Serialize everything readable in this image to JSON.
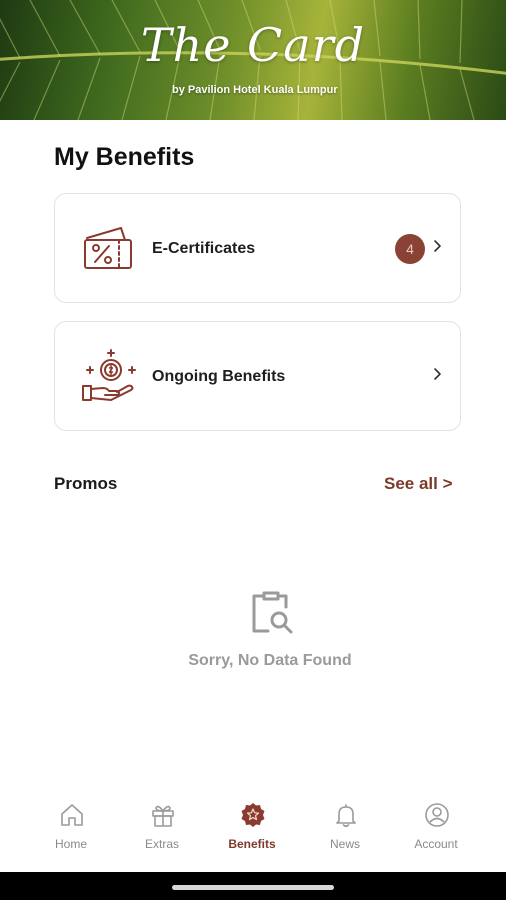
{
  "header": {
    "brand_title": "The Card",
    "brand_subtitle": "by Pavilion Hotel Kuala Lumpur"
  },
  "page": {
    "title": "My Benefits"
  },
  "benefits": [
    {
      "label": "E-Certificates",
      "icon": "ticket-percent-icon",
      "badge": "4"
    },
    {
      "label": "Ongoing Benefits",
      "icon": "hand-coins-icon"
    }
  ],
  "promos": {
    "title": "Promos",
    "see_all": "See all >",
    "empty_icon": "clipboard-search-icon",
    "empty_text": "Sorry, No Data Found"
  },
  "bottom_nav": {
    "items": [
      {
        "label": "Home",
        "icon": "home-icon"
      },
      {
        "label": "Extras",
        "icon": "gift-icon"
      },
      {
        "label": "Benefits",
        "icon": "badge-star-icon",
        "active": true
      },
      {
        "label": "News",
        "icon": "bell-icon"
      },
      {
        "label": "Account",
        "icon": "user-circle-icon"
      }
    ]
  },
  "colors": {
    "accent": "#7d3a2c",
    "badge_bg": "#8a4234",
    "muted": "#8a8a8a"
  }
}
